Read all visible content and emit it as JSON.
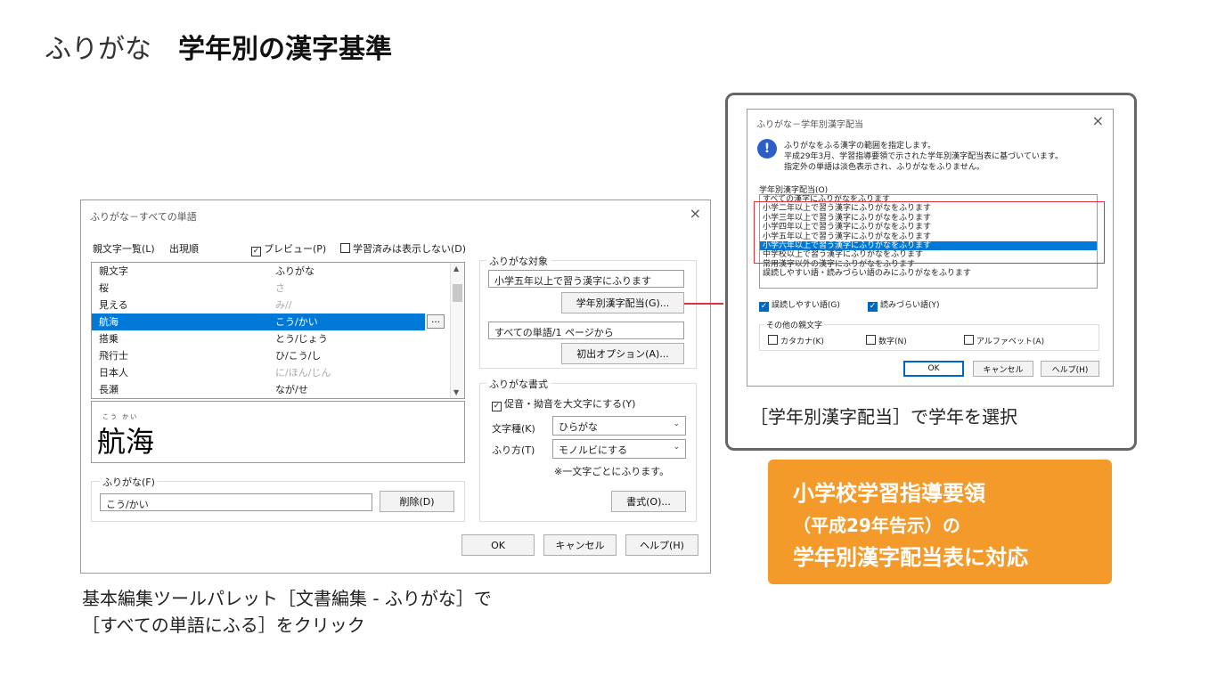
{
  "slide": {
    "title_light": "ふりがな",
    "title_bold": "学年別の漢字基準",
    "caption_line1": "基本編集ツールパレット［文書編集 - ふりがな］で",
    "caption_line2": "［すべての単語にふる］をクリック",
    "right_caption": "［学年別漢字配当］で学年を選択",
    "callout_line1": "小学校学習指導要領",
    "callout_line2": "（平成29年告示）の",
    "callout_line3": "学年別漢字配当表に対応",
    "callout_color": "#f39a2a",
    "highlight_color": "#e2313d"
  },
  "main_dialog": {
    "title": "ふりがな－すべての単語",
    "close": "×",
    "list_label": "親文字一覧(L)",
    "order_label": "出現順",
    "preview_label": "プレビュー(P)",
    "preview_checked": true,
    "hide_learned_label": "学習済みは表示しない(D)",
    "hide_learned_checked": false,
    "col_parent": "親文字",
    "col_furigana": "ふりがな",
    "rows": [
      {
        "parent": "桜",
        "furigana": "さ",
        "gray": true
      },
      {
        "parent": "見える",
        "furigana": "み//",
        "gray": true
      },
      {
        "parent": "航海",
        "furigana": "こう/かい",
        "selected": true
      },
      {
        "parent": "搭乗",
        "furigana": "とう/じょう"
      },
      {
        "parent": "飛行士",
        "furigana": "ひ/こう/し"
      },
      {
        "parent": "日本人",
        "furigana": "に/ほん/じん",
        "gray": true
      },
      {
        "parent": "長瀬",
        "furigana": "なが/せ"
      }
    ],
    "ellipsis": "…",
    "preview_big": "航海",
    "preview_ruby": [
      "こう",
      "かい"
    ],
    "furigana_group": "ふりがな(F)",
    "furigana_value": "こう/かい",
    "delete_button": "削除(D)",
    "target_group": "ふりがな対象",
    "target_value": "小学五年以上で習う漢字にふります",
    "grade_button": "学年別漢字配当(G)...",
    "scope_value": "すべての単語/1 ページから",
    "first_option_button": "初出オプション(A)...",
    "format_group": "ふりがな書式",
    "small_kana_label": "促音・拗音を大文字にする(Y)",
    "small_kana_checked": true,
    "char_type_label": "文字種(K)",
    "char_type_value": "ひらがな",
    "method_label": "ふり方(T)",
    "method_value": "モノルビにする",
    "method_note": "※一文字ごとにふります。",
    "format_button": "書式(O)...",
    "ok": "OK",
    "cancel": "キャンセル",
    "help": "ヘルプ(H)"
  },
  "grade_dialog": {
    "title": "ふりがな－学年別漢字配当",
    "close": "×",
    "info_line1": "ふりがなをふる漢字の範囲を指定します。",
    "info_line2": "平成29年3月、学習指導要領で示された学年別漢字配当表に基づいています。",
    "info_line3": "指定外の単語は淡色表示され、ふりがなをふりません。",
    "list_label": "学年別漢字配当(O)",
    "options": [
      "すべての漢字にふりがなをふります",
      "小学二年以上で習う漢字にふりがなをふります",
      "小学三年以上で習う漢字にふりがなをふります",
      "小学四年以上で習う漢字にふりがなをふります",
      "小学五年以上で習う漢字にふりがなをふります",
      "小学六年以上で習う漢字にふりがなをふります",
      "中学校以上で習う漢字にふりがなをふります",
      "常用漢字以外の漢字にふりがなをふります",
      "誤読しやすい語・読みづらい語のみにふりがなをふります"
    ],
    "selected_index": 5,
    "misread_label": "誤読しやすい語(G)",
    "hard_label": "読みづらい語(Y)",
    "other_group": "その他の親文字",
    "katakana_label": "カタカナ(K)",
    "digits_label": "数字(N)",
    "alphabet_label": "アルファベット(A)",
    "ok": "OK",
    "cancel": "キャンセル",
    "help": "ヘルプ(H)"
  }
}
